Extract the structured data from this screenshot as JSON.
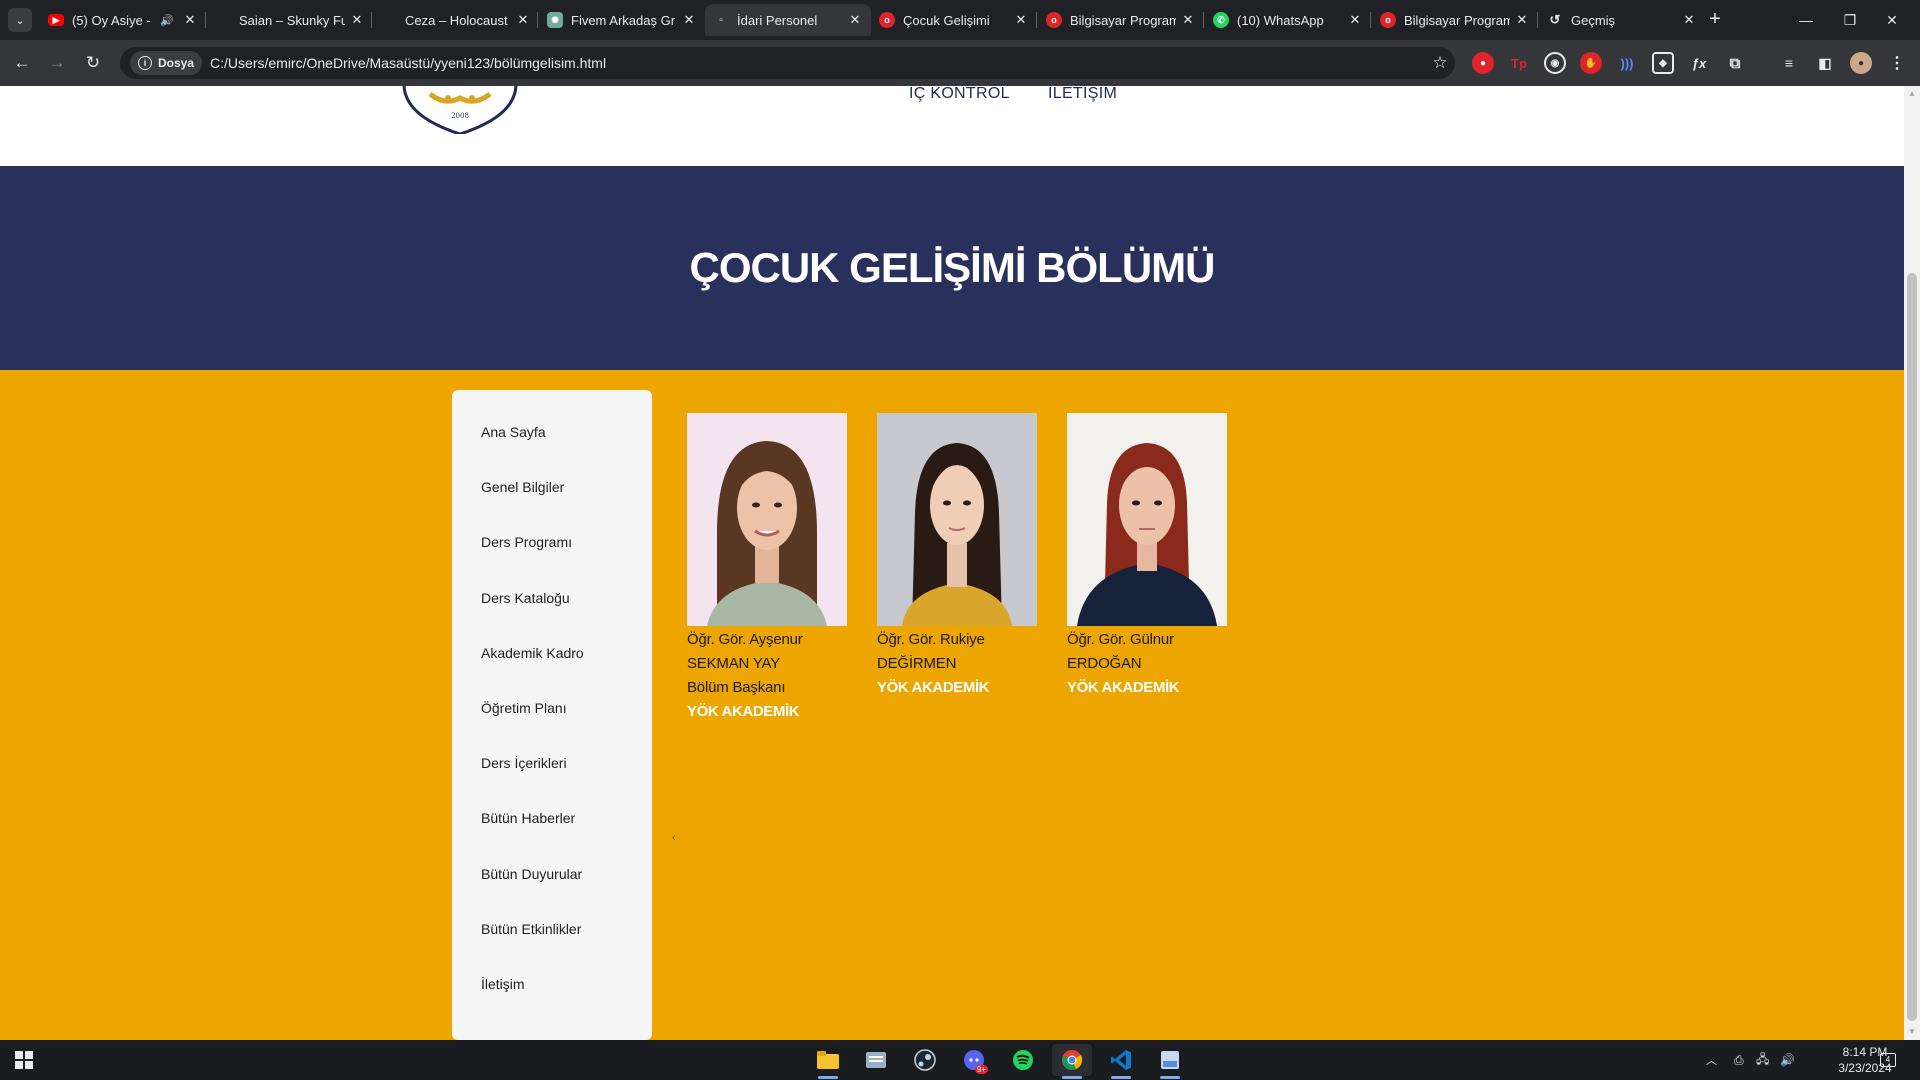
{
  "browser": {
    "tabs": [
      {
        "title": "(5) Oy Asiye -",
        "favicon": "youtube-icon",
        "audio": true
      },
      {
        "title": "Saian – Skunky Fu",
        "favicon": "none"
      },
      {
        "title": "Ceza – Holocaust",
        "favicon": "none"
      },
      {
        "title": "Fivem Arkadaş Gr",
        "favicon": "chatgpt-icon"
      },
      {
        "title": "İdari Personel",
        "favicon": "file-icon",
        "active": true
      },
      {
        "title": "Çocuk Gelişimi",
        "favicon": "opera-icon"
      },
      {
        "title": "Bilgisayar Program",
        "favicon": "opera-icon"
      },
      {
        "title": "(10) WhatsApp",
        "favicon": "whatsapp-icon"
      },
      {
        "title": "Bilgisayar Program",
        "favicon": "opera-icon"
      },
      {
        "title": "Geçmiş",
        "favicon": "history-icon"
      }
    ],
    "chip_label": "Dosya",
    "url": "C:/Users/emirc/OneDrive/Masaüstü/yyeni123/bölümgelisim.html"
  },
  "site": {
    "nav": {
      "item1": "İÇ KONTROL",
      "item2": "İLETİŞİM"
    },
    "logo_year": "2008",
    "hero_title": "ÇOCUK GELİŞİMİ BÖLÜMÜ",
    "menu": [
      "Ana Sayfa",
      "Genel Bilgiler",
      "Ders Programı",
      "Ders Kataloğu",
      "Akademik Kadro",
      "Öğretim Planı",
      "Ders İçerikleri",
      "Bütün Haberler",
      "Bütün Duyurular",
      "Bütün Etkinlikler",
      "İletişim"
    ],
    "staff": [
      {
        "line1": "Öğr. Gör. Ayşenur",
        "line2": "SEKMAN YAY",
        "role": "Bölüm Başkanı",
        "link": "YÖK AKADEMİK"
      },
      {
        "line1": "Öğr. Gör. Rukiye",
        "line2": "DEĞİRMEN",
        "role": "",
        "link": "YÖK AKADEMİK"
      },
      {
        "line1": "Öğr. Gör. Gülnur",
        "line2": "ERDOĞAN",
        "role": "",
        "link": "YÖK AKADEMİK"
      }
    ],
    "colors": {
      "hero": "#29305c",
      "content": "#eda600",
      "menu_bg": "#f5f5f5"
    }
  },
  "taskbar": {
    "apps": [
      "file-explorer-icon",
      "notepad-icon",
      "steam-icon",
      "discord-icon",
      "spotify-icon",
      "chrome-icon",
      "vscode-icon",
      "photos-icon"
    ],
    "discord_badge": "9+",
    "time": "8:14 PM",
    "date": "3/23/2024",
    "notification_count": "4"
  }
}
